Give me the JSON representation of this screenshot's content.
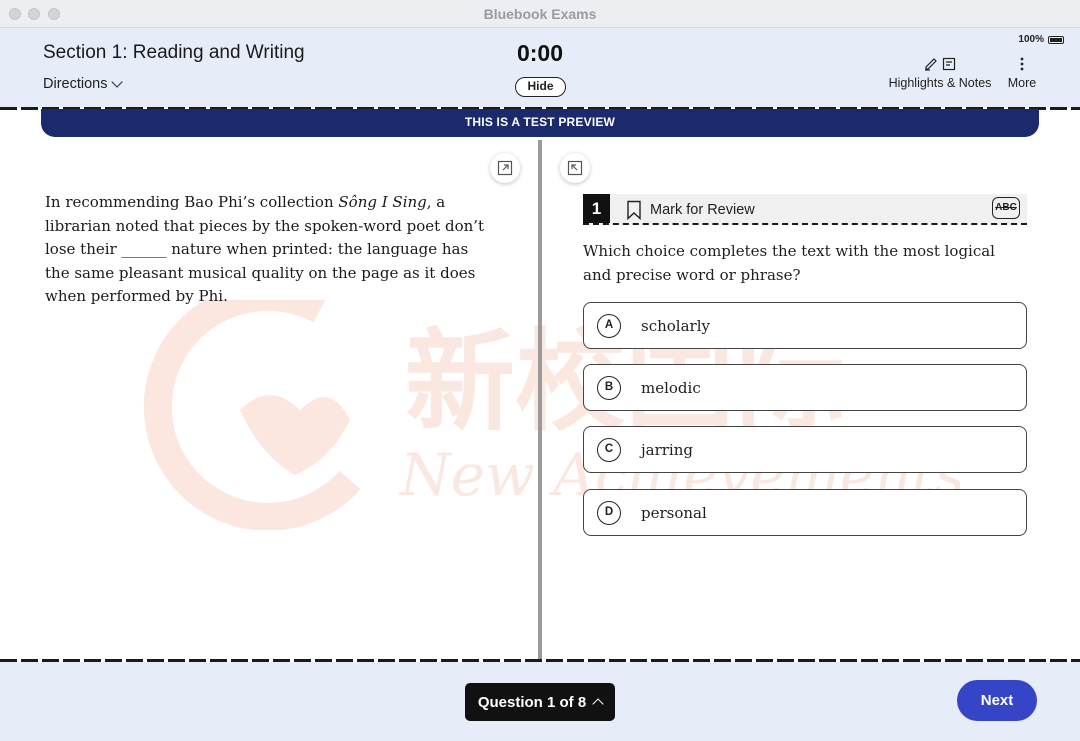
{
  "window": {
    "title": "Bluebook Exams"
  },
  "header": {
    "section_title": "Section 1: Reading and Writing",
    "directions_label": "Directions",
    "timer": "0:00",
    "hide_label": "Hide",
    "battery": "100%",
    "highlights_label": "Highlights & Notes",
    "more_label": "More"
  },
  "banner": {
    "text": "THIS IS A TEST PREVIEW"
  },
  "watermark": {
    "chinese": "新校国际",
    "english": "New Achievements"
  },
  "passage": {
    "before": "In recommending Bao Phi’s collection ",
    "title": "Sông I Sing",
    "after": ", a librarian noted that pieces by the spoken-word poet don’t lose their ______ nature when printed: the language has the same pleasant musical quality on the page as it does when performed by Phi."
  },
  "question": {
    "number": "1",
    "mark_label": "Mark for Review",
    "abc_label": "ABC",
    "stem": "Which choice completes the text with the most logical and precise word or phrase?",
    "choices": [
      {
        "letter": "A",
        "text": "scholarly"
      },
      {
        "letter": "B",
        "text": "melodic"
      },
      {
        "letter": "C",
        "text": "jarring"
      },
      {
        "letter": "D",
        "text": "personal"
      }
    ]
  },
  "footer": {
    "question_nav": "Question 1 of 8",
    "next_label": "Next"
  },
  "colors": {
    "header_bg": "#e6edf8",
    "banner_bg": "#1a2a6c",
    "next_bg": "#3545c7",
    "watermark": "#f7d3c8"
  }
}
